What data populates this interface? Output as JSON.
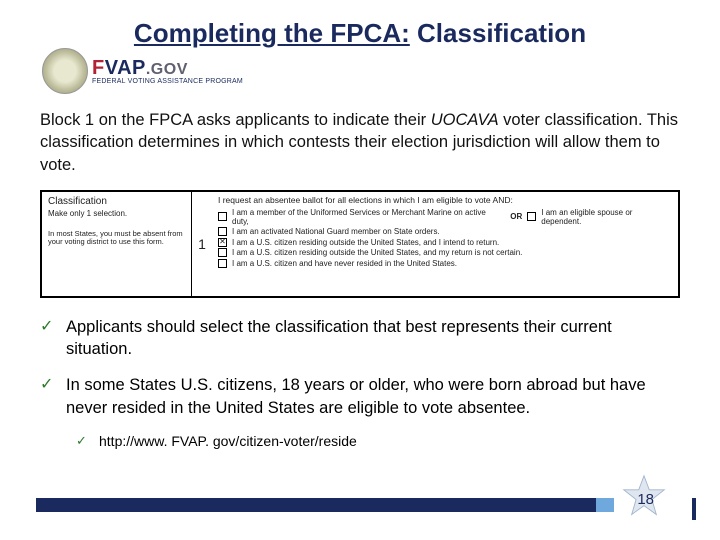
{
  "title_u": "Completing the FPCA:",
  "title_rest": " Classification",
  "logo": {
    "brand_f": "F",
    "brand_v": "VAP",
    "brand_dot": ".GOV",
    "sub": "FEDERAL VOTING ASSISTANCE PROGRAM"
  },
  "intro_a": "Block 1 on the FPCA asks applicants to indicate their ",
  "intro_it": "UOCAVA",
  "intro_b": " voter classification. This classification determines in which contests their election jurisdiction will allow them to vote.",
  "form": {
    "hdr": "Classification",
    "sub": "Make only 1 selection.",
    "note": "In most States, you must be absent from your voting district to use this form.",
    "num": "1",
    "lead": "I request an absentee ballot for all elections in which I am eligible to vote AND:",
    "opts": [
      {
        "chk": false,
        "text": "I am a member of the Uniformed Services or Merchant Marine on active duty,",
        "or": "OR",
        "extra_text": "I am an eligible spouse or dependent."
      },
      {
        "chk": false,
        "text": "I am an activated National Guard member on State orders."
      },
      {
        "chk": true,
        "text": "I am a U.S. citizen residing outside the United States, and I intend to return."
      },
      {
        "chk": false,
        "text": "I am a U.S. citizen residing outside the United States, and my return is not certain."
      },
      {
        "chk": false,
        "text": "I am a U.S. citizen and have never resided in the United States."
      }
    ]
  },
  "bullet1": "Applicants should select the classification that best represents their current situation.",
  "bullet2": "In some States U.S. citizens, 18 years or older, who were born abroad but have never resided in the United States are eligible to vote absentee.",
  "link": "http://www. FVAP. gov/citizen-voter/reside",
  "page": "18"
}
